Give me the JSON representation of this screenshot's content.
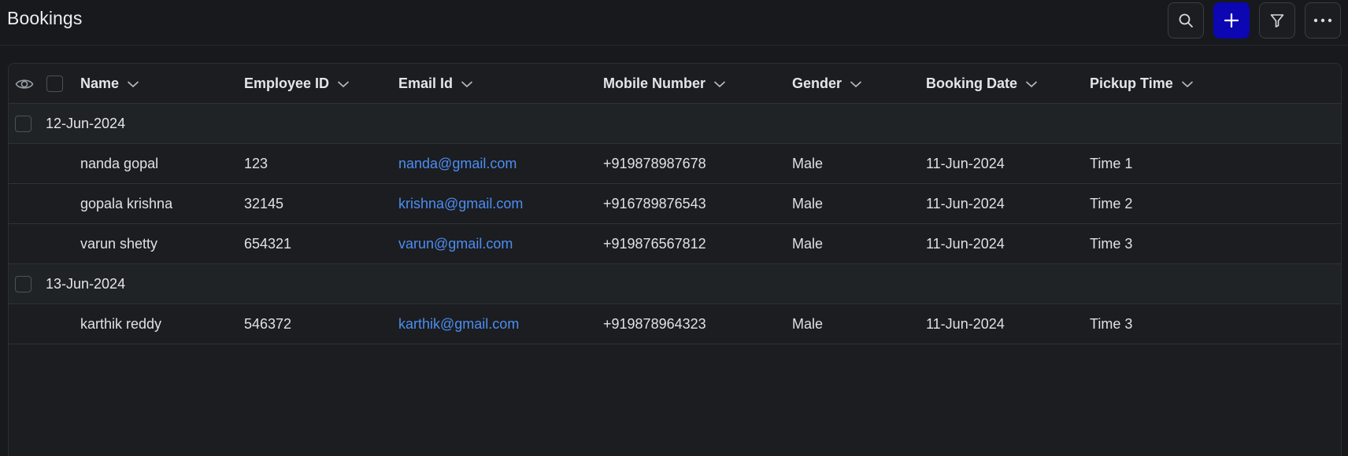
{
  "header": {
    "title": "Bookings",
    "buttons": [
      {
        "icon": "search-icon"
      },
      {
        "icon": "plus-icon"
      },
      {
        "icon": "filter-icon"
      },
      {
        "icon": "more-icon"
      }
    ]
  },
  "colors": {
    "background": "#17191c",
    "panel": "#1b1d20",
    "group_row": "#202326",
    "accent_button": "#0c06b3",
    "link": "#4d8df2",
    "text": "#e3e5e8"
  },
  "table": {
    "columns": [
      "Name",
      "Employee ID",
      "Email Id",
      "Mobile Number",
      "Gender",
      "Booking Date",
      "Pickup Time"
    ],
    "groups": [
      {
        "label": "12-Jun-2024",
        "rows": [
          [
            "nanda gopal",
            "123",
            "nanda@gmail.com",
            "+919878987678",
            "Male",
            "11-Jun-2024",
            "Time 1"
          ],
          [
            "gopala krishna",
            "32145",
            "krishna@gmail.com",
            "+916789876543",
            "Male",
            "11-Jun-2024",
            "Time 2"
          ],
          [
            "varun shetty",
            "654321",
            "varun@gmail.com",
            "+919876567812",
            "Male",
            "11-Jun-2024",
            "Time 3"
          ]
        ]
      },
      {
        "label": "13-Jun-2024",
        "rows": [
          [
            "karthik reddy",
            "546372",
            "karthik@gmail.com",
            "+919878964323",
            "Male",
            "11-Jun-2024",
            "Time 3"
          ]
        ]
      }
    ]
  }
}
